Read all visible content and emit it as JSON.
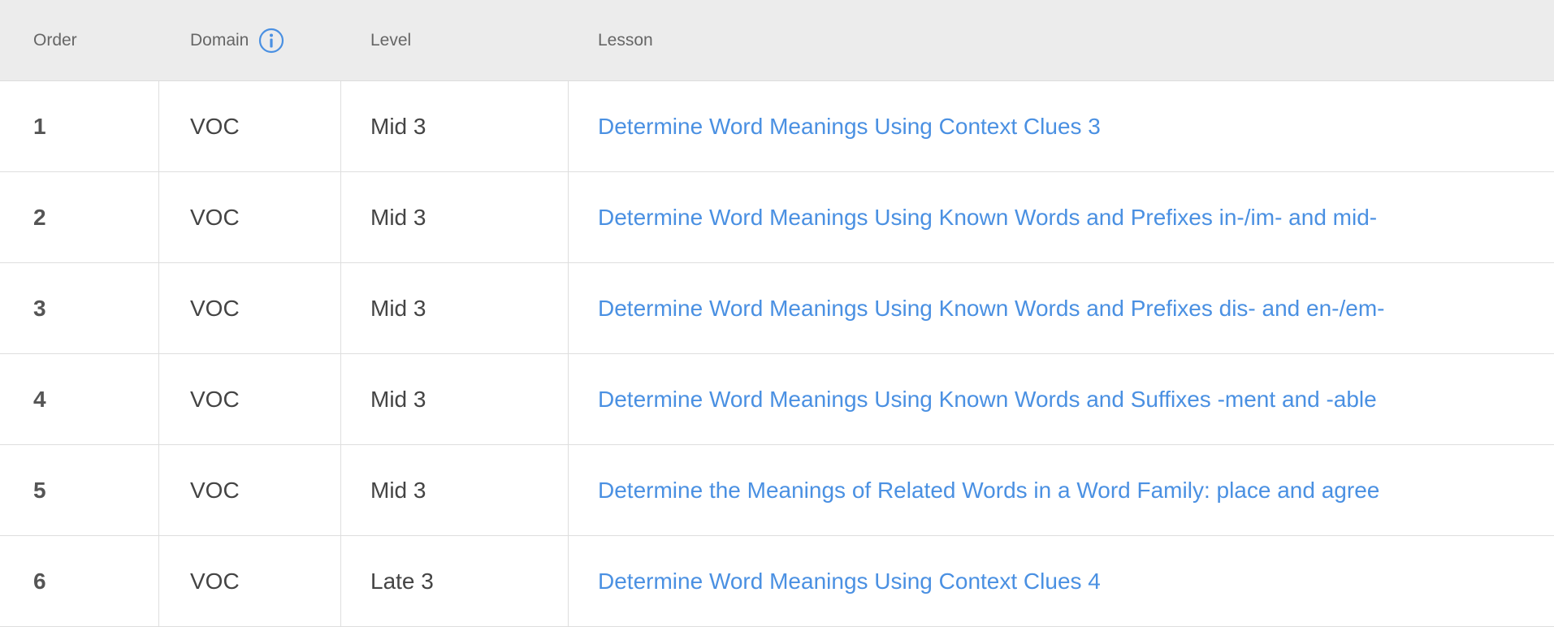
{
  "table": {
    "headers": {
      "order": "Order",
      "domain": "Domain",
      "level": "Level",
      "lesson": "Lesson"
    },
    "icons": {
      "domain_info": "info-icon"
    },
    "colors": {
      "link": "#4a90e2",
      "header_bg": "#ececec",
      "info_icon": "#4a90e2"
    },
    "rows": [
      {
        "order": "1",
        "domain": "VOC",
        "level": "Mid 3",
        "lesson": "Determine Word Meanings Using Context Clues 3"
      },
      {
        "order": "2",
        "domain": "VOC",
        "level": "Mid 3",
        "lesson": "Determine Word Meanings Using Known Words and Prefixes in-/im- and mid-"
      },
      {
        "order": "3",
        "domain": "VOC",
        "level": "Mid 3",
        "lesson": "Determine Word Meanings Using Known Words and Prefixes dis- and en-/em-"
      },
      {
        "order": "4",
        "domain": "VOC",
        "level": "Mid 3",
        "lesson": "Determine Word Meanings Using Known Words and Suffixes -ment and -able"
      },
      {
        "order": "5",
        "domain": "VOC",
        "level": "Mid 3",
        "lesson": "Determine the Meanings of Related Words in a Word Family: place and agree"
      },
      {
        "order": "6",
        "domain": "VOC",
        "level": "Late 3",
        "lesson": "Determine Word Meanings Using Context Clues 4"
      }
    ]
  }
}
